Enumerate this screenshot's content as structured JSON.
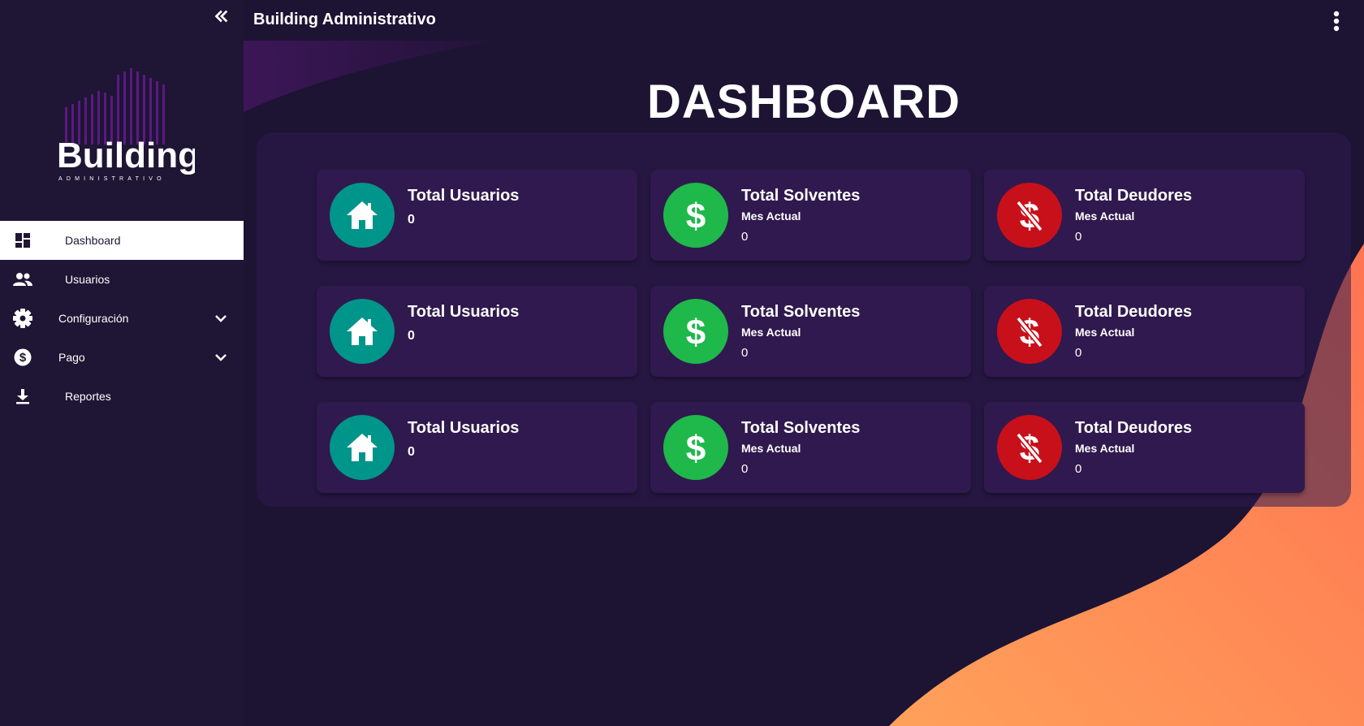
{
  "app": {
    "title": "Building Administrativo"
  },
  "logo": {
    "word": "Building",
    "tagline": "ADMINISTRATIVO"
  },
  "sidebar": {
    "items": [
      {
        "label": "Dashboard",
        "icon": "dashboard-icon",
        "active": true
      },
      {
        "label": "Usuarios",
        "icon": "users-icon"
      },
      {
        "label": "Configuración",
        "icon": "gear-icon",
        "expandable": true
      },
      {
        "label": "Pago",
        "icon": "dollar-circle-icon",
        "expandable": true
      },
      {
        "label": "Reportes",
        "icon": "download-icon"
      }
    ]
  },
  "main": {
    "title": "DASHBOARD",
    "cards": [
      {
        "title": "Total Usuarios",
        "value": "0",
        "icon": "home-icon",
        "color": "#00958a"
      },
      {
        "title": "Total Solventes",
        "subtitle": "Mes Actual",
        "value": "0",
        "icon": "dollar-icon",
        "color": "#1fb84a"
      },
      {
        "title": "Total Deudores",
        "subtitle": "Mes Actual",
        "value": "0",
        "icon": "money-off-icon",
        "color": "#c8101a"
      },
      {
        "title": "Total Usuarios",
        "value": "0",
        "icon": "home-icon",
        "color": "#00958a"
      },
      {
        "title": "Total Solventes",
        "subtitle": "Mes Actual",
        "value": "0",
        "icon": "dollar-icon",
        "color": "#1fb84a"
      },
      {
        "title": "Total Deudores",
        "subtitle": "Mes Actual",
        "value": "0",
        "icon": "money-off-icon",
        "color": "#c8101a"
      },
      {
        "title": "Total Usuarios",
        "value": "0",
        "icon": "home-icon",
        "color": "#00958a"
      },
      {
        "title": "Total Solventes",
        "subtitle": "Mes Actual",
        "value": "0",
        "icon": "dollar-icon",
        "color": "#1fb84a"
      },
      {
        "title": "Total Deudores",
        "subtitle": "Mes Actual",
        "value": "0",
        "icon": "money-off-icon",
        "color": "#c8101a"
      }
    ]
  },
  "colors": {
    "background": "#1d1333",
    "sidebar": "#1f1534",
    "card": "#30194e",
    "accent_orange": "#ff8a55"
  }
}
